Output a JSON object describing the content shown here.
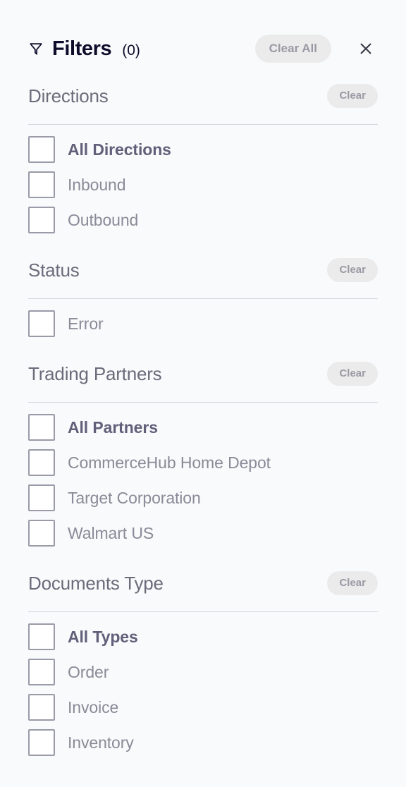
{
  "header": {
    "icon": "filter-funnel-icon",
    "title": "Filters",
    "count": "(0)",
    "clear_all_label": "Clear All",
    "close_icon": "close-icon"
  },
  "colors": {
    "background": "#f9fafb",
    "title": "#0d0d2b",
    "section_title": "#6b6b7b",
    "pill_background": "#ebebeb",
    "pill_text": "#9a9aa5",
    "divider": "#d6d6de",
    "checkbox_border": "#9a9aa8",
    "checkbox_fill": "#ffffff",
    "option_label": "#8a8a98",
    "option_label_all": "#60607a"
  },
  "sections": [
    {
      "id": "directions",
      "title": "Directions",
      "clear_label": "Clear",
      "options": [
        {
          "label": "All Directions",
          "checked": false,
          "is_all": true
        },
        {
          "label": "Inbound",
          "checked": false,
          "is_all": false
        },
        {
          "label": "Outbound",
          "checked": false,
          "is_all": false
        }
      ]
    },
    {
      "id": "status",
      "title": "Status",
      "clear_label": "Clear",
      "options": [
        {
          "label": "Error",
          "checked": false,
          "is_all": false
        }
      ]
    },
    {
      "id": "trading-partners",
      "title": "Trading Partners",
      "clear_label": "Clear",
      "options": [
        {
          "label": "All Partners",
          "checked": false,
          "is_all": true
        },
        {
          "label": "CommerceHub Home Depot",
          "checked": false,
          "is_all": false
        },
        {
          "label": "Target Corporation",
          "checked": false,
          "is_all": false
        },
        {
          "label": "Walmart US",
          "checked": false,
          "is_all": false
        }
      ]
    },
    {
      "id": "documents-type",
      "title": "Documents Type",
      "clear_label": "Clear",
      "options": [
        {
          "label": "All Types",
          "checked": false,
          "is_all": true
        },
        {
          "label": "Order",
          "checked": false,
          "is_all": false
        },
        {
          "label": "Invoice",
          "checked": false,
          "is_all": false
        },
        {
          "label": "Inventory",
          "checked": false,
          "is_all": false
        }
      ]
    }
  ]
}
